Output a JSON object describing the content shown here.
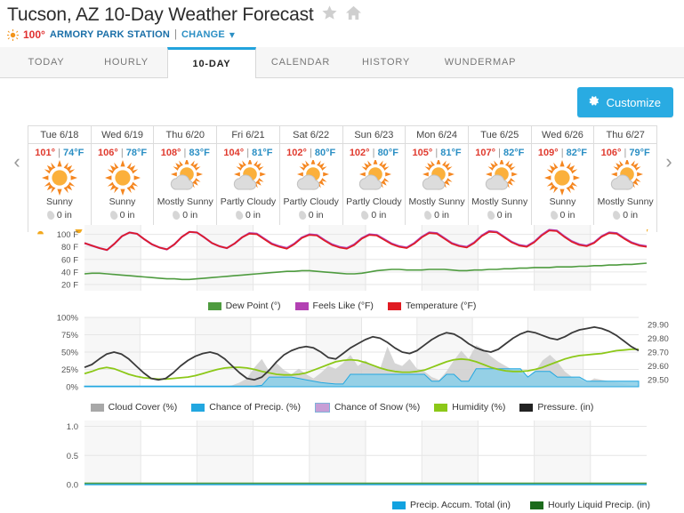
{
  "header": {
    "title": "Tucson, AZ 10-Day Weather Forecast",
    "star_icon": "star-icon",
    "home_icon": "home-icon",
    "current_temp": "100°",
    "station": "ARMORY PARK STATION",
    "separator": "|",
    "change_label": "CHANGE",
    "chevron": "chevron-down-icon",
    "sun_icon": "sun-icon"
  },
  "tabs": [
    {
      "label": "TODAY",
      "active": false
    },
    {
      "label": "HOURLY",
      "active": false
    },
    {
      "label": "10-DAY",
      "active": true
    },
    {
      "label": "CALENDAR",
      "active": false
    },
    {
      "label": "HISTORY",
      "active": false
    },
    {
      "label": "WUNDERMAP",
      "active": false
    }
  ],
  "toolbar": {
    "customize_label": "Customize",
    "gear_icon": "gear-icon"
  },
  "nav": {
    "prev_icon": "chevron-left-icon",
    "next_icon": "chevron-right-icon"
  },
  "forecast_days": [
    {
      "date": "Tue 6/18",
      "high": "101°",
      "sep": "|",
      "low": "74°F",
      "condition": "Sunny",
      "precip": "0 in",
      "icon": "sun-icon"
    },
    {
      "date": "Wed 6/19",
      "high": "106°",
      "sep": "|",
      "low": "78°F",
      "condition": "Sunny",
      "precip": "0 in",
      "icon": "sun-icon"
    },
    {
      "date": "Thu 6/20",
      "high": "108°",
      "sep": "|",
      "low": "83°F",
      "condition": "Mostly Sunny",
      "precip": "0 in",
      "icon": "sun-cloud-icon"
    },
    {
      "date": "Fri 6/21",
      "high": "104°",
      "sep": "|",
      "low": "81°F",
      "condition": "Partly Cloudy",
      "precip": "0 in",
      "icon": "sun-cloud-icon"
    },
    {
      "date": "Sat 6/22",
      "high": "102°",
      "sep": "|",
      "low": "80°F",
      "condition": "Partly Cloudy",
      "precip": "0 in",
      "icon": "sun-cloud-icon"
    },
    {
      "date": "Sun 6/23",
      "high": "102°",
      "sep": "|",
      "low": "80°F",
      "condition": "Partly Cloudy",
      "precip": "0 in",
      "icon": "sun-cloud-icon"
    },
    {
      "date": "Mon 6/24",
      "high": "105°",
      "sep": "|",
      "low": "81°F",
      "condition": "Mostly Sunny",
      "precip": "0 in",
      "icon": "sun-cloud-icon"
    },
    {
      "date": "Tue 6/25",
      "high": "107°",
      "sep": "|",
      "low": "82°F",
      "condition": "Mostly Sunny",
      "precip": "0 in",
      "icon": "sun-cloud-icon"
    },
    {
      "date": "Wed 6/26",
      "high": "109°",
      "sep": "|",
      "low": "82°F",
      "condition": "Sunny",
      "precip": "0 in",
      "icon": "sun-icon"
    },
    {
      "date": "Thu 6/27",
      "high": "106°",
      "sep": "|",
      "low": "79°F",
      "condition": "Mostly Sunny",
      "precip": "0 in",
      "icon": "sun-cloud-icon"
    }
  ],
  "colors": {
    "accent": "#29abe2",
    "temperature": "#e01b22",
    "feels_like": "#b341b3",
    "dew_point": "#4e9b3f",
    "cloud_cover": "#a8a8a8",
    "chance_precip": "#22a7e0",
    "chance_snow": "#c79ed6",
    "humidity": "#8cc818",
    "pressure": "#222222",
    "precip_accum": "#12a2e0",
    "hourly_liquid": "#1c6b1c"
  },
  "chart_data": [
    {
      "type": "line",
      "title": "Temperature Chart",
      "ylabel": "",
      "ylim": [
        10,
        115
      ],
      "yticks": [
        "20 F",
        "40 F",
        "60 F",
        "80 F",
        "100 F"
      ],
      "ytick_values": [
        20,
        40,
        60,
        80,
        100
      ],
      "grid": true,
      "legend_position": "bottom",
      "x_days": [
        "Tue 6/18",
        "Wed 6/19",
        "Thu 6/20",
        "Fri 6/21",
        "Sat 6/22",
        "Sun 6/23",
        "Mon 6/24",
        "Tue 6/25",
        "Wed 6/26",
        "Thu 6/27"
      ],
      "series": [
        {
          "name": "Temperature (°F)",
          "color": "#e01b22",
          "values": [
            86,
            82,
            78,
            75,
            85,
            97,
            103,
            101,
            92,
            84,
            79,
            76,
            84,
            96,
            104,
            103,
            95,
            86,
            81,
            78,
            85,
            95,
            101,
            100,
            92,
            84,
            80,
            77,
            84,
            94,
            99,
            98,
            90,
            83,
            79,
            77,
            83,
            93,
            99,
            98,
            91,
            84,
            80,
            78,
            85,
            95,
            102,
            101,
            93,
            85,
            81,
            79,
            86,
            97,
            104,
            103,
            95,
            87,
            82,
            80,
            87,
            98,
            106,
            105,
            96,
            88,
            83,
            81,
            86,
            96,
            102,
            101,
            93,
            86,
            82,
            80
          ]
        },
        {
          "name": "Feels Like (°F)",
          "color": "#b341b3",
          "values": [
            86,
            82,
            78,
            75,
            85,
            97,
            103,
            101,
            92,
            84,
            79,
            76,
            84,
            96,
            104,
            103,
            95,
            86,
            81,
            78,
            85,
            95,
            102,
            101,
            93,
            85,
            81,
            78,
            85,
            95,
            100,
            99,
            91,
            84,
            80,
            78,
            84,
            94,
            100,
            99,
            92,
            85,
            81,
            79,
            86,
            96,
            103,
            102,
            94,
            86,
            82,
            80,
            87,
            98,
            105,
            104,
            96,
            88,
            83,
            81,
            88,
            99,
            107,
            106,
            97,
            89,
            84,
            82,
            87,
            97,
            103,
            102,
            94,
            87,
            83,
            81
          ]
        },
        {
          "name": "Dew Point (°)",
          "color": "#4e9b3f",
          "values": [
            37,
            38,
            38,
            37,
            36,
            35,
            34,
            33,
            32,
            31,
            30,
            29,
            29,
            28,
            28,
            29,
            30,
            31,
            32,
            33,
            34,
            35,
            36,
            37,
            38,
            39,
            40,
            41,
            41,
            42,
            42,
            41,
            40,
            39,
            38,
            37,
            37,
            38,
            40,
            42,
            43,
            44,
            44,
            43,
            43,
            43,
            44,
            44,
            44,
            43,
            42,
            42,
            43,
            43,
            44,
            44,
            45,
            45,
            46,
            46,
            47,
            47,
            47,
            48,
            48,
            48,
            49,
            49,
            50,
            50,
            51,
            51,
            52,
            52,
            53,
            54
          ]
        }
      ]
    },
    {
      "type": "line",
      "title": "Humidity / Cloud / Pressure Chart",
      "ylim": [
        0,
        100
      ],
      "yticks": [
        "0%",
        "25%",
        "50%",
        "75%",
        "100%"
      ],
      "ytick_values": [
        0,
        25,
        50,
        75,
        100
      ],
      "y2ticks": [
        "29.50",
        "29.60",
        "29.70",
        "29.80",
        "29.90"
      ],
      "y2lim": [
        29.45,
        29.95
      ],
      "grid": true,
      "legend_position": "bottom",
      "series": [
        {
          "name": "Cloud Cover (%)",
          "color": "#a8a8a8",
          "type": "area",
          "values": [
            0,
            0,
            0,
            0,
            0,
            0,
            0,
            0,
            0,
            0,
            0,
            0,
            0,
            0,
            0,
            0,
            0,
            0,
            0,
            0,
            2,
            6,
            12,
            28,
            40,
            22,
            34,
            24,
            18,
            26,
            18,
            12,
            20,
            30,
            26,
            34,
            46,
            30,
            38,
            30,
            26,
            58,
            34,
            30,
            40,
            26,
            22,
            14,
            10,
            22,
            38,
            52,
            40,
            60,
            54,
            44,
            36,
            30,
            24,
            18,
            14,
            22,
            38,
            46,
            36,
            22,
            14,
            10,
            6,
            12,
            10,
            8,
            6,
            4,
            2,
            2
          ]
        },
        {
          "name": "Chance of Precip. (%)",
          "color": "#22a7e0",
          "type": "area",
          "values": [
            1,
            1,
            1,
            1,
            1,
            1,
            1,
            1,
            1,
            1,
            1,
            1,
            1,
            1,
            1,
            1,
            1,
            1,
            1,
            1,
            1,
            1,
            1,
            1,
            2,
            14,
            14,
            14,
            14,
            12,
            10,
            8,
            6,
            5,
            4,
            4,
            18,
            18,
            18,
            18,
            18,
            18,
            18,
            18,
            18,
            18,
            18,
            8,
            8,
            18,
            18,
            8,
            8,
            26,
            26,
            26,
            26,
            26,
            26,
            26,
            14,
            22,
            22,
            22,
            14,
            14,
            14,
            14,
            8,
            8,
            8,
            8,
            8,
            8,
            8,
            8
          ]
        },
        {
          "name": "Chance of Snow (%)",
          "color": "#c79ed6",
          "type": "area",
          "values": [
            0,
            0,
            0,
            0,
            0,
            0,
            0,
            0,
            0,
            0,
            0,
            0,
            0,
            0,
            0,
            0,
            0,
            0,
            0,
            0,
            0,
            0,
            0,
            0,
            0,
            0,
            0,
            0,
            0,
            0,
            0,
            0,
            0,
            0,
            0,
            0,
            0,
            0,
            0,
            0,
            0,
            0,
            0,
            0,
            0,
            0,
            0,
            0,
            0,
            0,
            0,
            0,
            0,
            0,
            0,
            0,
            0,
            0,
            0,
            0,
            0,
            0,
            0,
            0,
            0,
            0,
            0,
            0,
            0,
            0,
            0,
            0,
            0,
            0,
            0,
            0
          ]
        },
        {
          "name": "Humidity (%)",
          "color": "#8cc818",
          "values": [
            19,
            22,
            26,
            28,
            26,
            22,
            18,
            15,
            13,
            12,
            11,
            11,
            12,
            13,
            14,
            16,
            19,
            22,
            25,
            27,
            28,
            28,
            27,
            25,
            22,
            20,
            18,
            17,
            17,
            18,
            20,
            24,
            28,
            32,
            36,
            38,
            39,
            38,
            35,
            31,
            27,
            24,
            22,
            21,
            21,
            22,
            24,
            28,
            32,
            36,
            39,
            40,
            39,
            36,
            32,
            28,
            25,
            23,
            22,
            22,
            23,
            25,
            28,
            32,
            36,
            40,
            43,
            45,
            46,
            47,
            48,
            50,
            52,
            53,
            54,
            54
          ]
        },
        {
          "name": "Pressure. (in)",
          "color": "#222222",
          "values": [
            28,
            32,
            40,
            47,
            50,
            47,
            40,
            30,
            20,
            12,
            10,
            12,
            20,
            30,
            38,
            44,
            48,
            50,
            47,
            40,
            30,
            20,
            12,
            10,
            14,
            24,
            36,
            46,
            52,
            56,
            58,
            56,
            50,
            42,
            40,
            48,
            56,
            62,
            68,
            72,
            70,
            64,
            56,
            50,
            48,
            52,
            60,
            68,
            74,
            78,
            76,
            70,
            62,
            56,
            52,
            50,
            54,
            62,
            70,
            76,
            80,
            78,
            74,
            70,
            68,
            72,
            78,
            82,
            84,
            86,
            84,
            80,
            74,
            66,
            58,
            52
          ]
        }
      ]
    },
    {
      "type": "line",
      "title": "Precipitation Chart",
      "ylim": [
        0,
        1.1
      ],
      "yticks": [
        "0.0",
        "0.5",
        "1.0"
      ],
      "ytick_values": [
        0.0,
        0.5,
        1.0
      ],
      "grid": true,
      "legend_position": "bottom",
      "series": [
        {
          "name": "Precip. Accum. Total (in)",
          "color": "#12a2e0",
          "values": [
            0,
            0,
            0,
            0,
            0,
            0,
            0,
            0,
            0,
            0
          ]
        },
        {
          "name": "Hourly Liquid Precip. (in)",
          "color": "#1c6b1c",
          "values": [
            0,
            0,
            0,
            0,
            0,
            0,
            0,
            0,
            0,
            0
          ]
        }
      ]
    }
  ],
  "legends": {
    "chart1": [
      {
        "label": "Dew Point (°)",
        "color": "#4e9b3f"
      },
      {
        "label": "Feels Like (°F)",
        "color": "#b341b3"
      },
      {
        "label": "Temperature (°F)",
        "color": "#e01b22"
      }
    ],
    "chart2": [
      {
        "label": "Cloud Cover (%)",
        "color": "#a8a8a8"
      },
      {
        "label": "Chance of Precip. (%)",
        "color": "#22a7e0"
      },
      {
        "label": "Chance of Snow (%)",
        "color": "#c79ed6"
      },
      {
        "label": "Humidity (%)",
        "color": "#8cc818"
      },
      {
        "label": "Pressure. (in)",
        "color": "#222222"
      }
    ],
    "chart3": [
      {
        "label": "Precip. Accum. Total (in)",
        "color": "#12a2e0"
      },
      {
        "label": "Hourly Liquid Precip. (in)",
        "color": "#1c6b1c"
      }
    ]
  }
}
